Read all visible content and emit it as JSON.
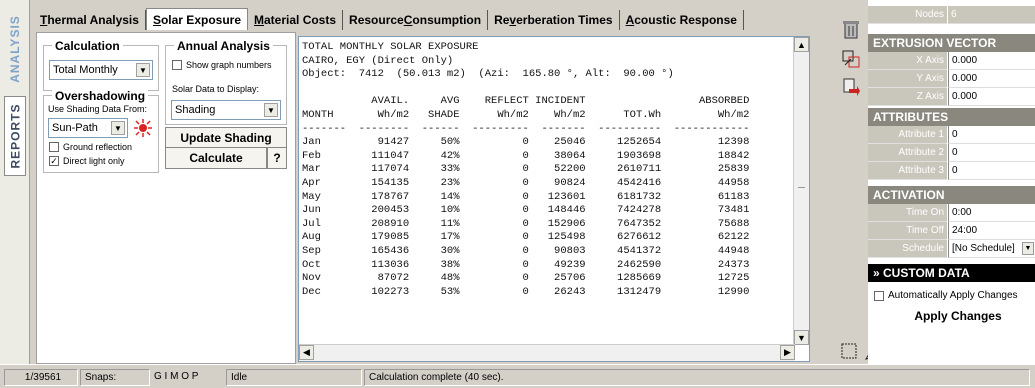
{
  "side_tabs": {
    "analysis": "ANALYSIS",
    "reports": "REPORTS"
  },
  "tabs": [
    {
      "label": "Thermal Analysis"
    },
    {
      "label": "Solar Exposure"
    },
    {
      "label": "Material Costs"
    },
    {
      "label": "Resource Consumption"
    },
    {
      "label": "Reverberation Times"
    },
    {
      "label": "Acoustic Response"
    }
  ],
  "calculation": {
    "title": "Calculation",
    "value": "Total Monthly"
  },
  "annual": {
    "title": "Annual Analysis",
    "show_graph_numbers": "Show graph numbers",
    "solar_data_label": "Solar Data to Display:",
    "solar_data_value": "Shading"
  },
  "overshadowing": {
    "title": "Overshadowing",
    "use_label": "Use Shading Data From:",
    "source": "Sun-Path",
    "ground_reflection": "Ground reflection",
    "direct_light_only": "Direct light only"
  },
  "buttons": {
    "update_shading": "Update Shading",
    "calculate": "Calculate",
    "help": "?"
  },
  "results": {
    "header": [
      "TOTAL MONTHLY SOLAR EXPOSURE",
      "CAIRO, EGY (Direct Only)",
      "Object:  7412  (50.013 m2)  (Azi:  165.80 °, Alt:  90.00 °)"
    ],
    "col_head_1": [
      "",
      "AVAIL.",
      "AVG",
      "REFLECT",
      "INCIDENT",
      "",
      "ABSORBED"
    ],
    "col_head_2": [
      "MONTH",
      "Wh/m2",
      "SHADE",
      "Wh/m2",
      "Wh/m2",
      "TOT.Wh",
      "Wh/m2"
    ],
    "rows": [
      [
        "Jan",
        "91427",
        "50%",
        "0",
        "25046",
        "1252654",
        "12398"
      ],
      [
        "Feb",
        "111047",
        "42%",
        "0",
        "38064",
        "1903698",
        "18842"
      ],
      [
        "Mar",
        "117074",
        "33%",
        "0",
        "52200",
        "2610711",
        "25839"
      ],
      [
        "Apr",
        "154135",
        "23%",
        "0",
        "90824",
        "4542416",
        "44958"
      ],
      [
        "May",
        "178767",
        "14%",
        "0",
        "123601",
        "6181732",
        "61183"
      ],
      [
        "Jun",
        "200453",
        "10%",
        "0",
        "148446",
        "7424278",
        "73481"
      ],
      [
        "Jul",
        "208910",
        "11%",
        "0",
        "152906",
        "7647352",
        "75688"
      ],
      [
        "Aug",
        "179085",
        "17%",
        "0",
        "125498",
        "6276612",
        "62122"
      ],
      [
        "Sep",
        "165436",
        "30%",
        "0",
        "90803",
        "4541372",
        "44948"
      ],
      [
        "Oct",
        "113036",
        "38%",
        "0",
        "49239",
        "2462590",
        "24373"
      ],
      [
        "Nov",
        "87072",
        "48%",
        "0",
        "25706",
        "1285669",
        "12725"
      ],
      [
        "Dec",
        "102273",
        "53%",
        "0",
        "26243",
        "1312479",
        "12990"
      ]
    ]
  },
  "properties": {
    "nodes_label": "Nodes",
    "nodes_value": "6",
    "extrusion_title": "EXTRUSION VECTOR",
    "x_label": "X Axis",
    "x_value": "0.000",
    "y_label": "Y Axis",
    "y_value": "0.000",
    "z_label": "Z Axis",
    "z_value": "0.000",
    "attributes_title": "ATTRIBUTES",
    "attr1_label": "Attribute 1",
    "attr1_value": "0",
    "attr2_label": "Attribute 2",
    "attr2_value": "0",
    "attr3_label": "Attribute 3",
    "attr3_value": "0",
    "activation_title": "ACTIVATION",
    "on_label": "Time On",
    "on_value": "0:00",
    "off_label": "Time Off",
    "off_value": "24:00",
    "sched_label": "Schedule",
    "sched_value": "[No Schedule]",
    "custom_title": "» CUSTOM DATA",
    "auto_apply": "Automatically Apply Changes",
    "apply": "Apply Changes"
  },
  "status": {
    "coords": "1/39561",
    "snaps_label": "Snaps:",
    "snap_flags": "G I   M O P",
    "mode": "Idle",
    "message": "Calculation complete (40 sec)."
  },
  "colors": {
    "header_dark": "#8a877e",
    "label_grey": "#c9c6bc",
    "custom_black": "#000000",
    "icon_red": "#cc2222"
  }
}
